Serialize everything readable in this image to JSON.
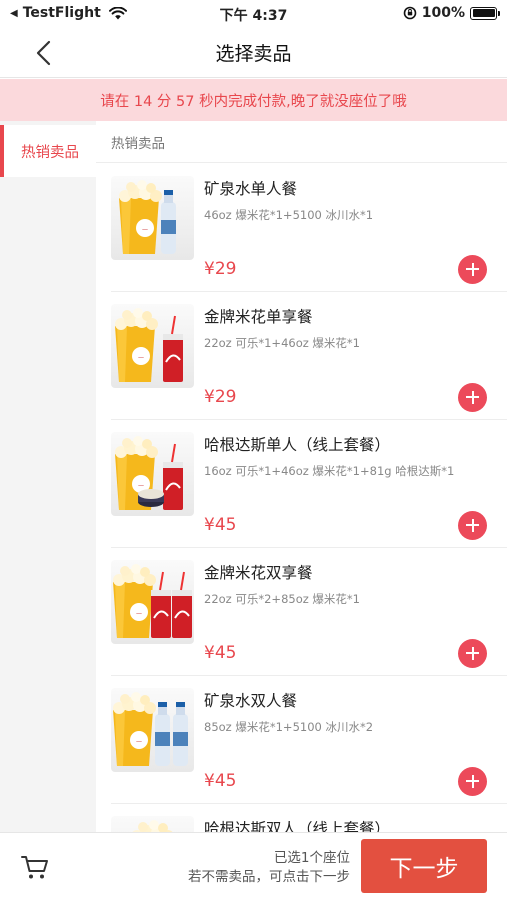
{
  "status_bar": {
    "carrier": "TestFlight",
    "time": "下午 4:37",
    "battery": "100%"
  },
  "nav": {
    "title": "选择卖品"
  },
  "notice": {
    "text": "请在 14 分 57 秒内完成付款,晚了就没座位了哦"
  },
  "sidebar": {
    "items": [
      {
        "label": "热销卖品"
      }
    ]
  },
  "section": {
    "header": "热销卖品"
  },
  "products": [
    {
      "name": "矿泉水单人餐",
      "desc": "46oz 爆米花*1+5100 冰川水*1",
      "price": "¥29",
      "image": "popcorn-water"
    },
    {
      "name": "金牌米花单享餐",
      "desc": "22oz 可乐*1+46oz 爆米花*1",
      "price": "¥29",
      "image": "popcorn-cola"
    },
    {
      "name": "哈根达斯单人（线上套餐）",
      "desc": "16oz 可乐*1+46oz 爆米花*1+81g 哈根达斯*1",
      "price": "¥45",
      "image": "popcorn-cola-icecream"
    },
    {
      "name": "金牌米花双享餐",
      "desc": "22oz 可乐*2+85oz 爆米花*1",
      "price": "¥45",
      "image": "popcorn-two-cola"
    },
    {
      "name": "矿泉水双人餐",
      "desc": "85oz 爆米花*1+5100 冰川水*2",
      "price": "¥45",
      "image": "popcorn-two-water"
    },
    {
      "name": "哈根达斯双人（线上套餐）",
      "desc": "",
      "price": "",
      "image": "popcorn"
    }
  ],
  "footer": {
    "selected_text": "已选1个座位",
    "hint_text": "若不需卖品，可点击下一步",
    "next_label": "下一步"
  },
  "colors": {
    "accent": "#e8474d",
    "notice_bg": "#fbd9dc",
    "next_button": "#e35040"
  }
}
